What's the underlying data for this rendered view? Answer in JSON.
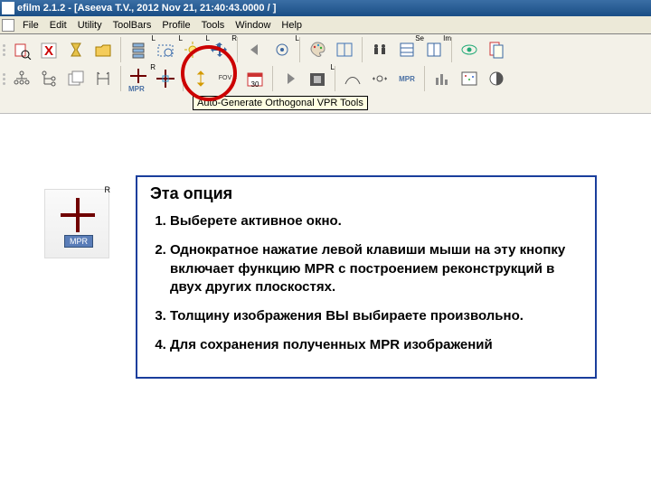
{
  "titlebar": {
    "text": "efilm 2.1.2 - [Aseeva T.V., 2012 Nov 21, 21:40:43.0000  /  ]"
  },
  "menu": {
    "items": [
      "File",
      "Edit",
      "Utility",
      "ToolBars",
      "Profile",
      "Tools",
      "Window",
      "Help"
    ]
  },
  "toolbar": {
    "row1_sups": [
      "",
      "",
      "",
      "",
      "L",
      "L",
      "L",
      "R",
      "",
      "L",
      "",
      "",
      "",
      "Se",
      "Im",
      "",
      ""
    ],
    "row2_sups": [
      "",
      "",
      "",
      "",
      "R",
      "",
      "",
      "",
      "",
      "L",
      "",
      "",
      "",
      "",
      "",
      "",
      ""
    ],
    "mpr_label": "MPR",
    "fov_label": "FOV\n=",
    "cal_badge": "30"
  },
  "tooltip": {
    "text": "Auto-Generate Orthogonal VPR Tools"
  },
  "snippet": {
    "label": "MPR",
    "r": "R"
  },
  "instructions": {
    "title": "Эта опция",
    "items": [
      "Выберете активное окно.",
      "Однократное нажатие левой клавиши мыши на эту кнопку  включает функцию MPR с построением реконструкций в двух других плоскостях.",
      "Толщину изображения ВЫ выбираете произвольно.",
      "Для сохранения полученных MPR изображений"
    ]
  }
}
